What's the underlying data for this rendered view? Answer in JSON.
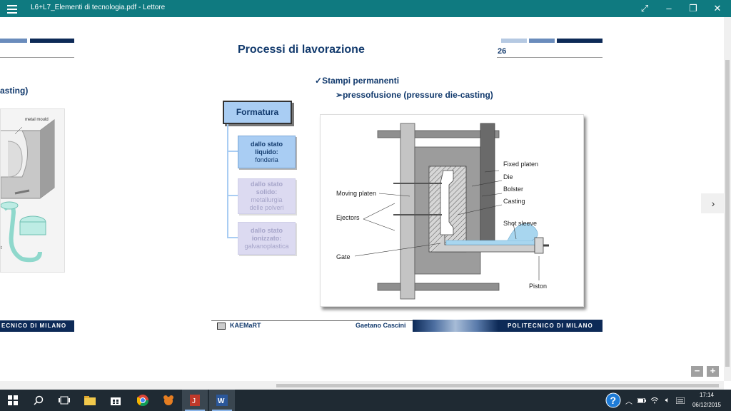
{
  "window": {
    "title": "L6+L7_Elementi di tecnologia.pdf - Lettore"
  },
  "left_page": {
    "partial_heading": "asting)",
    "figure_labels": {
      "metal_mould": "metal mould",
      "partial_t": "t"
    },
    "footer": "ECNICO DI MILANO"
  },
  "slide": {
    "title": "Processi di lavorazione",
    "page_number": "26",
    "bullet1": "Stampi permanenti",
    "bullet2": "pressofusione (pressure die-casting)",
    "tree_root": "Formatura",
    "tree_items": [
      {
        "lines": [
          "dallo stato",
          "liquido:",
          "fonderia"
        ],
        "active": true
      },
      {
        "lines": [
          "dallo stato",
          "solido:",
          "metallurgia",
          "delle polveri"
        ],
        "active": false
      },
      {
        "lines": [
          "dallo stato",
          "ionizzato:",
          "galvanoplastica"
        ],
        "active": false
      }
    ],
    "diagram_labels": {
      "fixed_platen": "Fixed platen",
      "die": "Die",
      "bolster": "Bolster",
      "casting": "Casting",
      "moving_platen": "Moving platen",
      "ejectors": "Ejectors",
      "shot_sleeve": "Shot sleeve",
      "gate": "Gate",
      "piston": "Piston"
    },
    "footer": {
      "brand": "KAEMaRT",
      "author": "Gaetano Cascini",
      "institution": "POLITECNICO DI MILANO"
    }
  },
  "taskbar": {
    "time": "17:14",
    "date": "06/12/2015"
  }
}
